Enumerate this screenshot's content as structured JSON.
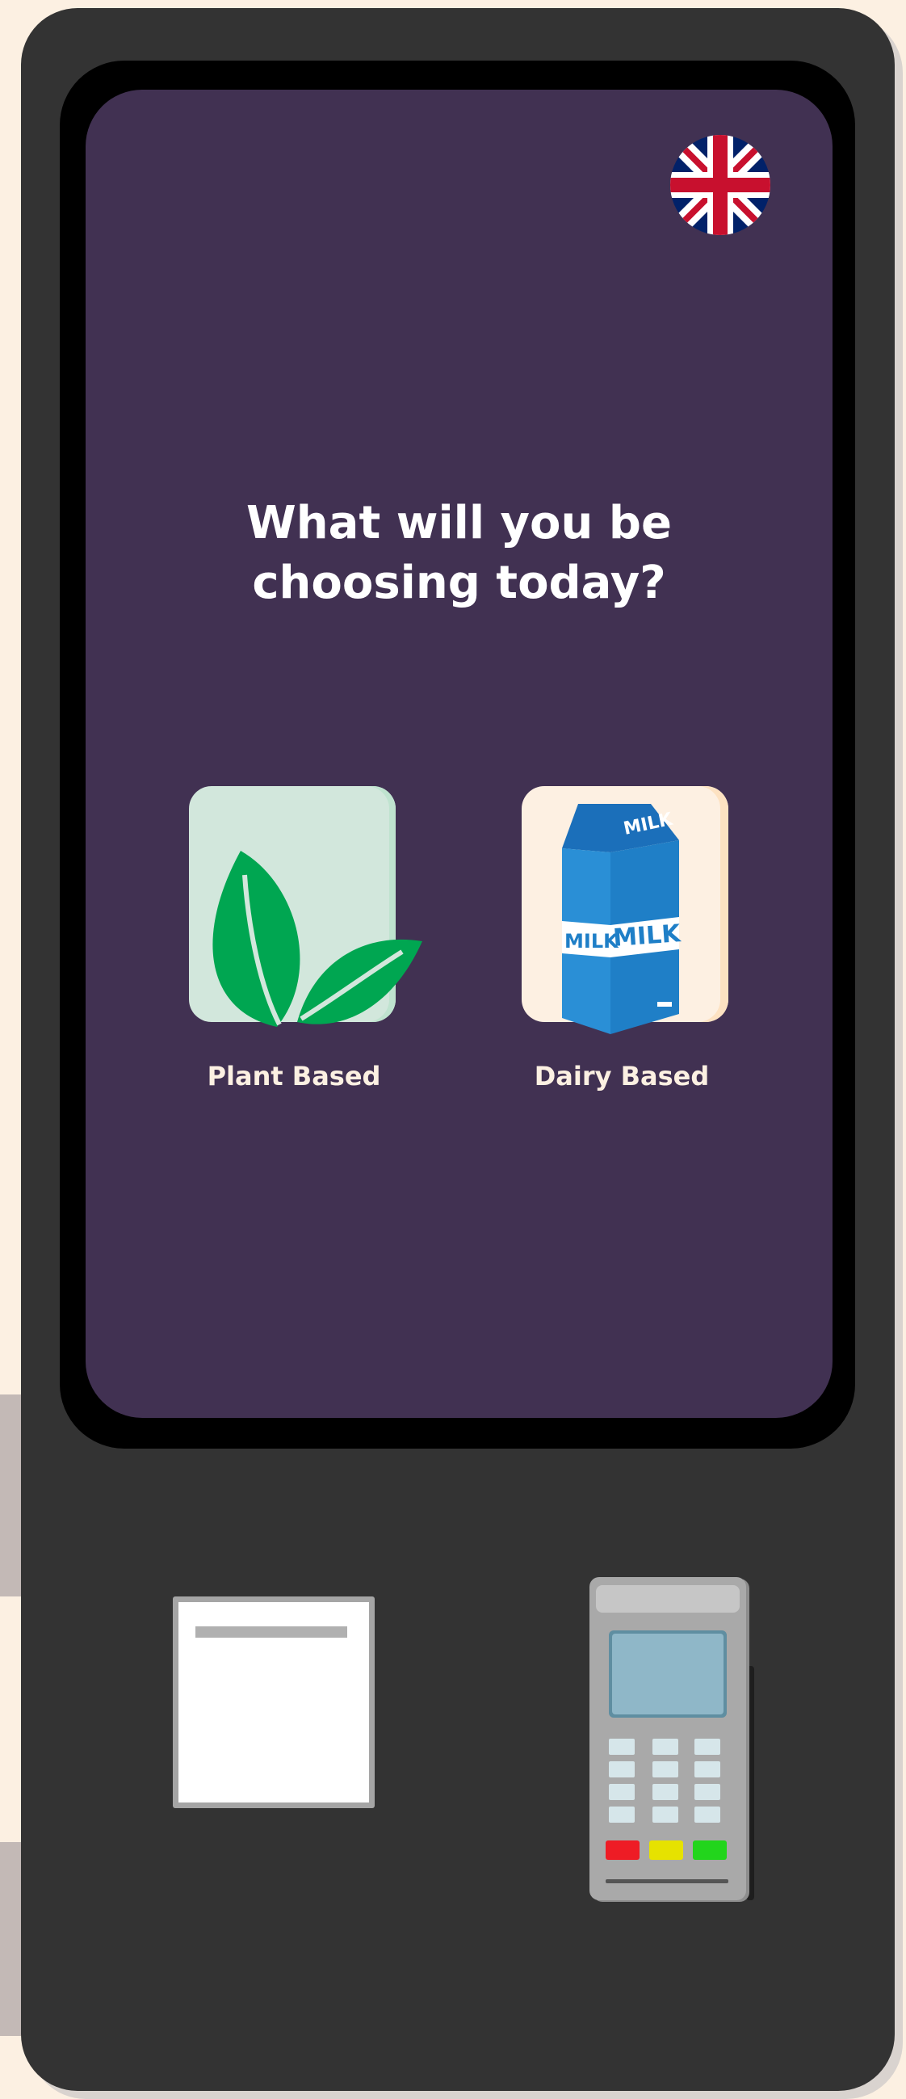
{
  "language": {
    "flag_icon": "uk-flag-icon"
  },
  "question": {
    "text": "What will you be\nchoosing today?"
  },
  "options": [
    {
      "label": "Plant Based",
      "icon": "leaves-icon"
    },
    {
      "label": "Dairy Based",
      "icon": "milk-carton-icon"
    }
  ],
  "milk_carton": {
    "top_text": "MILK",
    "side_text": "MILK",
    "front_text": "MILK"
  },
  "colors": {
    "background": "#fcf0e2",
    "kiosk_body": "#333333",
    "screen": "#413152",
    "plant_card": "#d2e7dc",
    "dairy_card": "#fdf0e2",
    "leaf_green": "#00a651",
    "milk_blue": "#1f7fc7"
  },
  "hardware": {
    "printer_icon": "receipt-printer-icon",
    "terminal_icon": "card-terminal-icon"
  }
}
